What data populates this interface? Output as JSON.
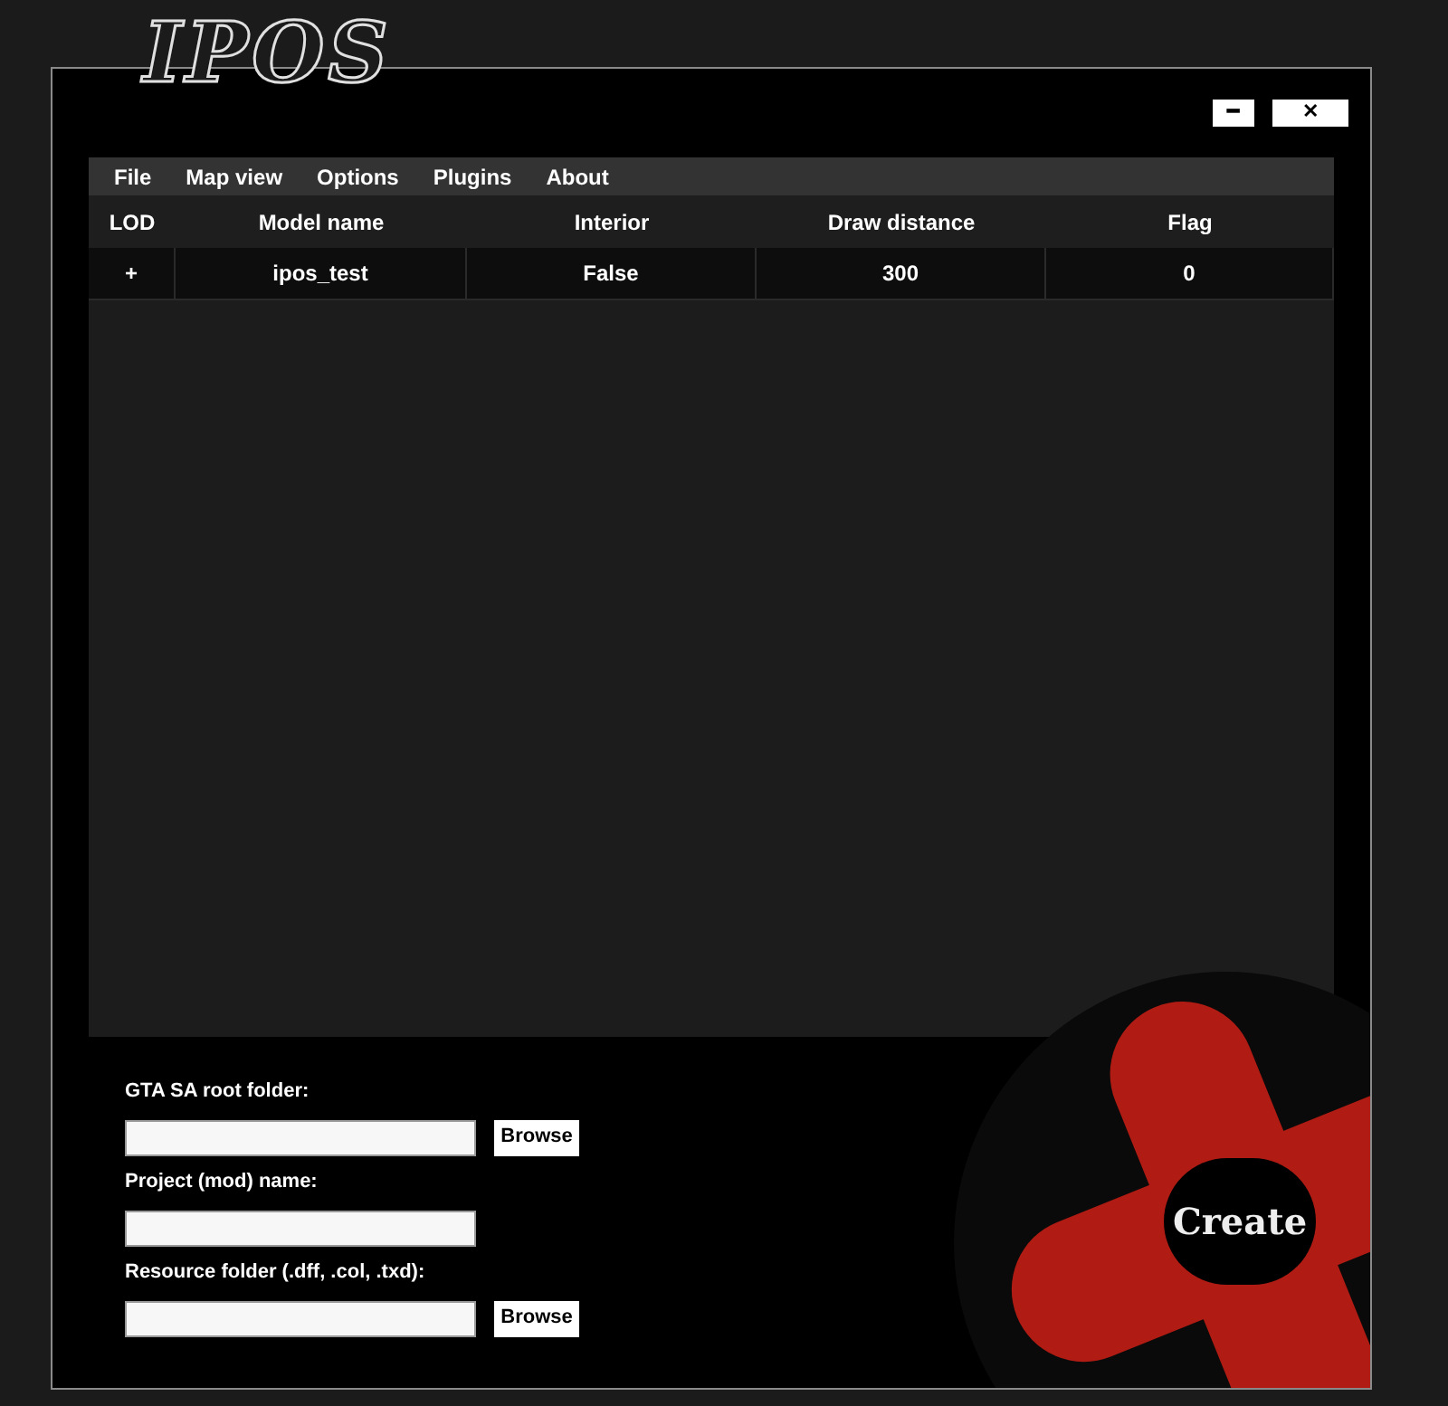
{
  "logo": "IPOS",
  "window_buttons": [
    {
      "kind": "minimize",
      "label": "━"
    },
    {
      "kind": "close",
      "label": "✕"
    }
  ],
  "menu": [
    "File",
    "Map view",
    "Options",
    "Plugins",
    "About"
  ],
  "table": {
    "columns": [
      "LOD",
      "Model name",
      "Interior",
      "Draw distance",
      "Flag"
    ],
    "rows": [
      [
        "+",
        "ipos_test",
        "False",
        "300",
        "0"
      ]
    ]
  },
  "form": [
    {
      "label": "GTA SA root folder:",
      "browse": "Browse"
    },
    {
      "label": "Project (mod) name:"
    },
    {
      "label": "Resource folder (.dff, .col, .txd):",
      "browse": "Browse"
    }
  ],
  "create_button": "Create"
}
